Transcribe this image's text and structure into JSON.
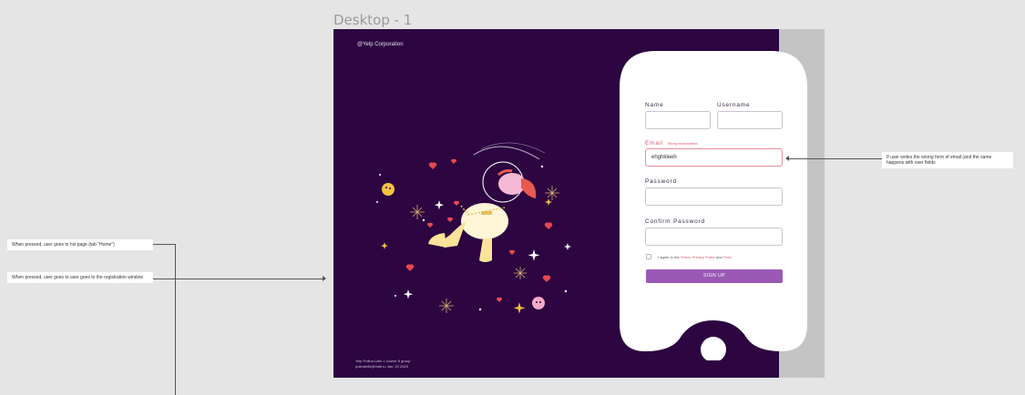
{
  "frame_title": "Desktop - 1",
  "brand": "@Yelp Corporation",
  "footer": {
    "line1": "Yelp   Polina Lelik   1 course 8 group",
    "line2": "polinalelik@mail.ru    Jan, 20  2025"
  },
  "form": {
    "name_label": "Name",
    "username_label": "Username",
    "email_label": "Email",
    "email_error": "Wrong email address",
    "email_value": "ehghkleeh",
    "password_label": "Password",
    "confirm_label": "Confirm Password",
    "agree_prefix": "I agree to the ",
    "terms": "Terms",
    "sep1": ", ",
    "privacy": "Privacy Police",
    "and": " and ",
    "fees": "Fees",
    "agree_suffix": ".",
    "signup_label": "SIGN UP"
  },
  "notes": {
    "home": "When pressed, user goes to his page (tab \"Home\")",
    "registration": "When pressed, user goes to user goes to the registration window",
    "email": "If user writes the wrong form of email (and the same happens with over fields"
  },
  "colors": {
    "frame_bg": "#2c0541",
    "accent": "#9b59b6",
    "error": "#e0566b"
  }
}
